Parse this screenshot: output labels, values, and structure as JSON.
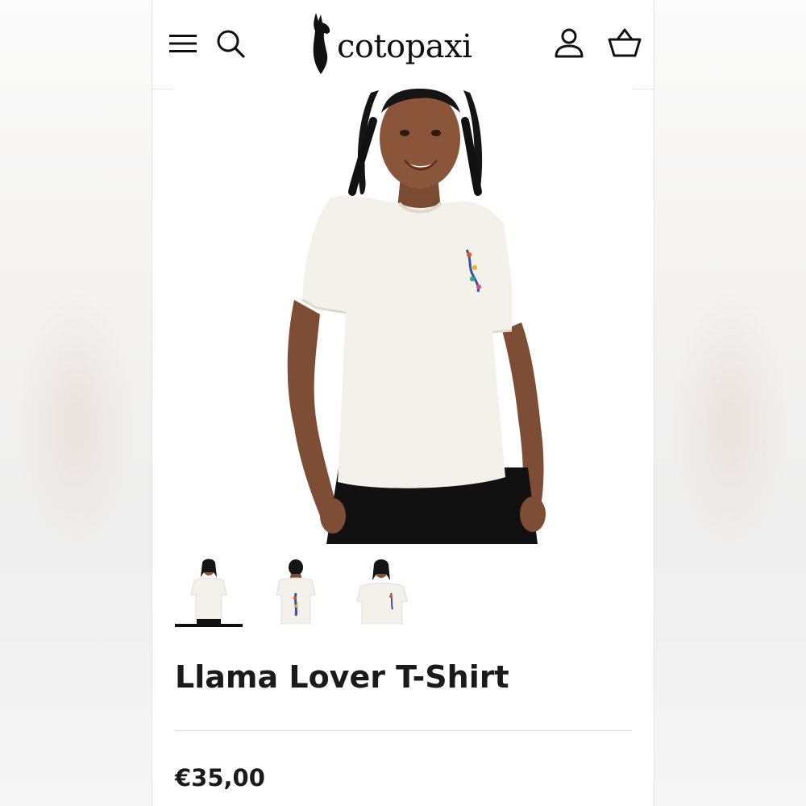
{
  "header": {
    "menu_icon": "hamburger-menu-icon",
    "search_icon": "search-icon",
    "logo_text": "cotopaxi",
    "account_icon": "user-account-icon",
    "cart_icon": "basket-cart-icon"
  },
  "product": {
    "title": "Llama Lover T-Shirt",
    "price": "€35,00",
    "thumbnails": [
      {
        "view": "front",
        "selected": true
      },
      {
        "view": "back",
        "selected": false
      },
      {
        "view": "front",
        "selected": false
      }
    ]
  },
  "colors": {
    "text": "#1a1a1a",
    "shirt": "#f3f1ea",
    "divider": "#d9d9d9"
  }
}
